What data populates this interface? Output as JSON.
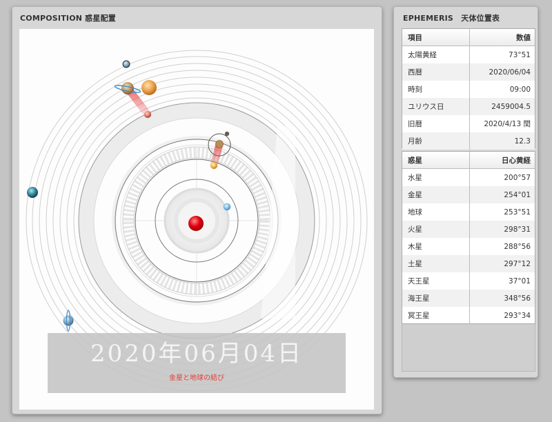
{
  "composition": {
    "title": "COMPOSITION 惑星配置",
    "date_display": "2020年06月04日",
    "caption": "金星と地球の結び"
  },
  "ephemeris": {
    "title": "EPHEMERIS　天体位置表",
    "info_table": {
      "headers": [
        "項目",
        "数値"
      ],
      "rows": [
        {
          "label": "太陽黄経",
          "value": "73°51"
        },
        {
          "label": "西暦",
          "value": "2020/06/04"
        },
        {
          "label": "時刻",
          "value": "09:00"
        },
        {
          "label": "ユリウス日",
          "value": "2459004.5"
        },
        {
          "label": "旧暦",
          "value": "2020/4/13 閏"
        },
        {
          "label": "月齢",
          "value": "12.3"
        }
      ]
    },
    "planet_table": {
      "headers": [
        "惑星",
        "日心黄経"
      ],
      "rows": [
        {
          "label": "水星",
          "value": "200°57"
        },
        {
          "label": "金星",
          "value": "254°01"
        },
        {
          "label": "地球",
          "value": "253°51"
        },
        {
          "label": "火星",
          "value": "298°31"
        },
        {
          "label": "木星",
          "value": "288°56"
        },
        {
          "label": "土星",
          "value": "297°12"
        },
        {
          "label": "天王星",
          "value": "37°01"
        },
        {
          "label": "海王星",
          "value": "348°56"
        },
        {
          "label": "冥王星",
          "value": "293°34"
        }
      ]
    }
  },
  "colors": {
    "sun": "#e00010",
    "connection_line": "#e83a3a",
    "caption": "#e0403a",
    "panel_bg": "#d7d7d7"
  },
  "icons": [
    "sun-icon",
    "mercury-icon",
    "venus-icon",
    "earth-icon",
    "moon-icon",
    "mars-icon",
    "jupiter-icon",
    "saturn-icon",
    "uranus-icon",
    "neptune-icon",
    "pluto-icon"
  ]
}
